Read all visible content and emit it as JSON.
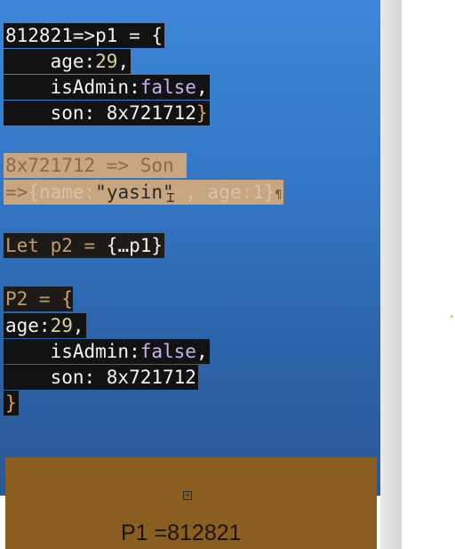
{
  "code": {
    "p1_block": {
      "line1": "812821=>p1 = {",
      "line2_key": "    age:",
      "line2_val": "29",
      "line2_tail": ",",
      "line3_key": "    isAdmin:",
      "line3_val": "false",
      "line3_tail": ",",
      "line4_key": "    son: 8x721712",
      "line4_tail": "}"
    },
    "son_block": {
      "line1": "8x721712 => Son ",
      "line2_arrow": "=>",
      "line2_open": "{",
      "line2_name": "name:",
      "line2_string_a": "\"yas",
      "line2_string_b": "in\"",
      "line2_rest": " , age:1",
      "line2_close": "}",
      "pilcrow": "¶"
    },
    "spread_line": {
      "text_a": "Let p2 = ",
      "text_b": "{…p1}"
    },
    "p2_block": {
      "line1_a": "P2 = ",
      "line1_b": "{",
      "line2_key": "age:",
      "line2_val": "29",
      "line2_tail": ",",
      "line3_key": "    isAdmin:",
      "line3_val": "false",
      "line3_tail": ",",
      "line4": "    son: 8x721712",
      "line5": "}"
    }
  },
  "panel": {
    "label": "P1 =812821",
    "icon": "square-plus-icon"
  },
  "colors": {
    "slide_blue": "#3478c8",
    "code_bg": "#121212",
    "highlight_tan": "#c7a680",
    "panel_brown": "#8a5e20"
  }
}
